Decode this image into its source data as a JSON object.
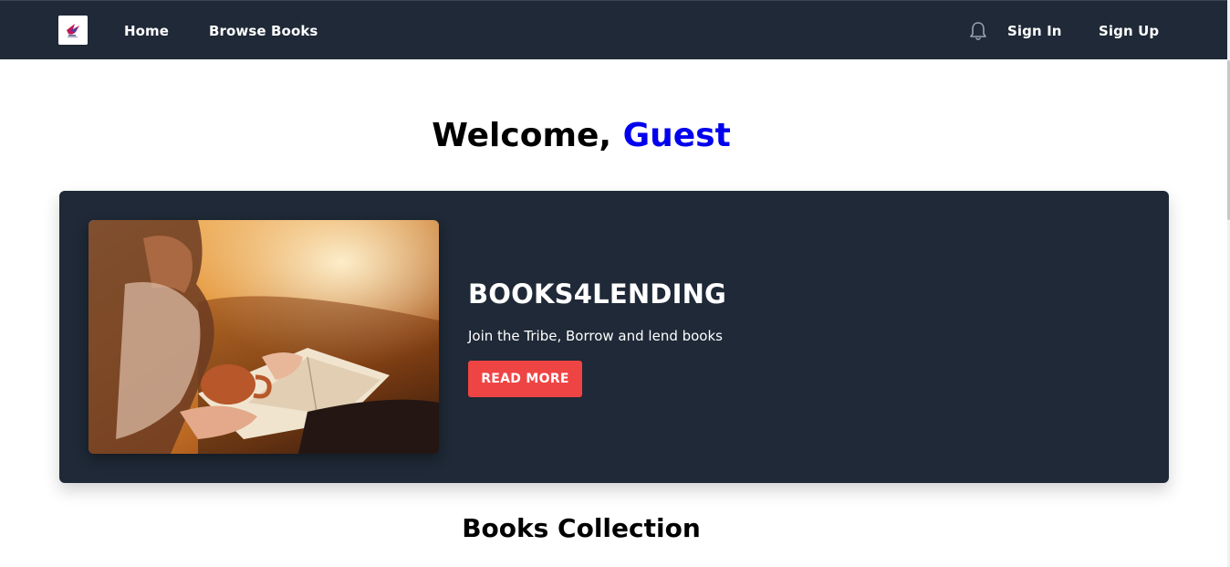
{
  "nav": {
    "home": "Home",
    "browse_books": "Browse Books",
    "sign_in": "Sign In",
    "sign_up": "Sign Up",
    "logo_icon": "bird-logo-icon",
    "bell_icon": "bell-icon"
  },
  "welcome": {
    "prefix": "Welcome, ",
    "name": "Guest",
    "name_color": "#0000ee"
  },
  "hero": {
    "title": "BOOKS4LENDING",
    "subtitle": "Join the Tribe, Borrow and lend books",
    "button": "READ MORE",
    "button_color": "#ef4444",
    "background": "#1f2937"
  },
  "collection": {
    "title": "Books Collection"
  }
}
